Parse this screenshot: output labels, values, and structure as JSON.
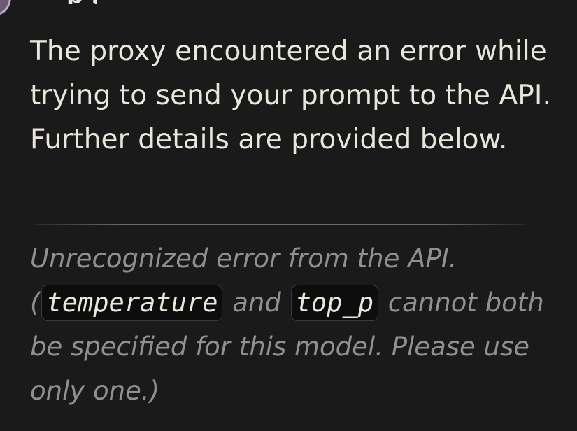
{
  "header": {
    "title_fragment": "p ,"
  },
  "message": {
    "lead": "The proxy encountered an error while trying to send your prompt to the API. Further details are provided below."
  },
  "error": {
    "line1": "Unrecognized error from the API.",
    "paren_open": "(",
    "code_temperature": "temperature",
    "and_text": " and ",
    "code_top_p": "top_p",
    "rest": " cannot both be specified for this model. Please use only one.)"
  },
  "colors": {
    "background": "#1a1a1a",
    "text": "#e9e6dc",
    "muted": "#909090",
    "code_bg": "#0d0d0d"
  }
}
